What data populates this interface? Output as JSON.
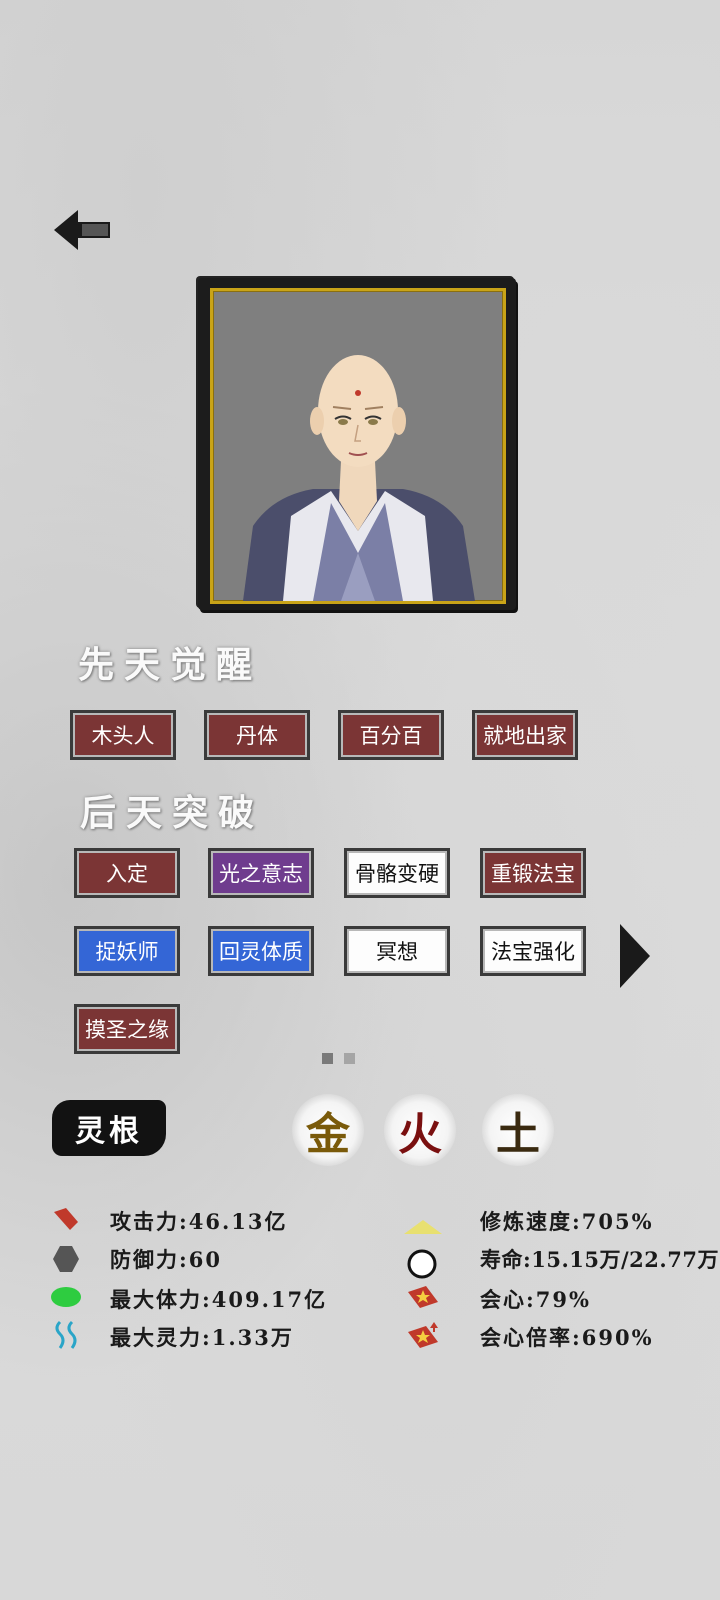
{
  "header": {
    "back_icon": "arrow-left-icon"
  },
  "portrait": {
    "description_icon": "character-portrait"
  },
  "innate": {
    "title": "先天觉醒",
    "tags": [
      {
        "label": "木头人",
        "color": "red"
      },
      {
        "label": "丹体",
        "color": "red"
      },
      {
        "label": "百分百",
        "color": "red"
      },
      {
        "label": "就地出家",
        "color": "red"
      }
    ]
  },
  "acquired": {
    "title": "后天突破",
    "tags": [
      {
        "label": "入定",
        "color": "red"
      },
      {
        "label": "光之意志",
        "color": "purple"
      },
      {
        "label": "骨骼变硬",
        "color": "white"
      },
      {
        "label": "重锻法宝",
        "color": "red"
      },
      {
        "label": "捉妖师",
        "color": "blue"
      },
      {
        "label": "回灵体质",
        "color": "blue"
      },
      {
        "label": "冥想",
        "color": "white"
      },
      {
        "label": "法宝强化",
        "color": "white"
      },
      {
        "label": "摸圣之缘",
        "color": "red"
      }
    ],
    "next_icon": "triangle-right-icon",
    "pages": 2,
    "current_page": 1
  },
  "spirit_root": {
    "label": "灵根",
    "elements": [
      {
        "char": "金",
        "color": "#7a5a0a"
      },
      {
        "char": "火",
        "color": "#7a1010"
      },
      {
        "char": "土",
        "color": "#3a2a10"
      }
    ]
  },
  "stats": {
    "left": [
      {
        "label": "攻击力:46.13亿",
        "icon": "attack-icon",
        "icon_color": "#c0392b"
      },
      {
        "label": "防御力:60",
        "icon": "defense-icon",
        "icon_color": "#555555"
      },
      {
        "label": "最大体力:409.17亿",
        "icon": "health-icon",
        "icon_color": "#2ecc40"
      },
      {
        "label": "最大灵力:1.33万",
        "icon": "mana-icon",
        "icon_color": "#2aa5c8"
      }
    ],
    "right": [
      {
        "label": "修炼速度:705%",
        "icon": "cultivation-speed-icon",
        "icon_color": "#e8e070"
      },
      {
        "label": "寿命:15.15万/22.77万",
        "icon": "lifespan-icon",
        "icon_color": "#ffffff"
      },
      {
        "label": "会心:79%",
        "icon": "critical-icon",
        "icon_color": "#c0392b"
      },
      {
        "label": "会心倍率:690%",
        "icon": "critical-multiplier-icon",
        "icon_color": "#c0392b"
      }
    ]
  }
}
